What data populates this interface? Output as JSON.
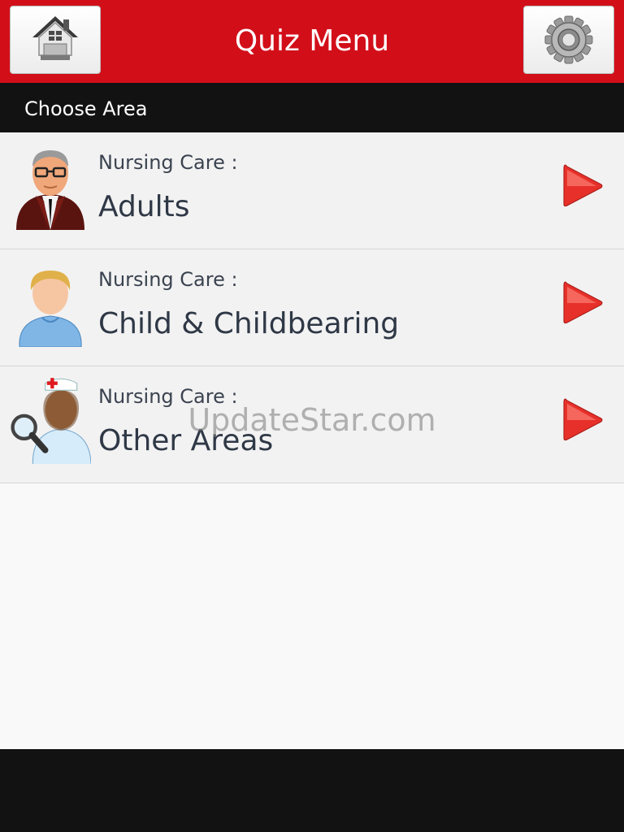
{
  "header": {
    "title": "Quiz Menu",
    "home_icon": "home-icon",
    "settings_icon": "gear-icon",
    "brand_color": "#d20f19"
  },
  "subheader": {
    "label": "Choose Area"
  },
  "areas": [
    {
      "kicker": "Nursing Care :",
      "name": "Adults",
      "icon": "elderly-man-icon"
    },
    {
      "kicker": "Nursing Care :",
      "name": "Child & Childbearing",
      "icon": "child-icon"
    },
    {
      "kicker": "Nursing Care :",
      "name": "Other Areas",
      "icon": "nurse-with-magnifier-icon"
    }
  ],
  "watermark": "UpdateStar.com"
}
